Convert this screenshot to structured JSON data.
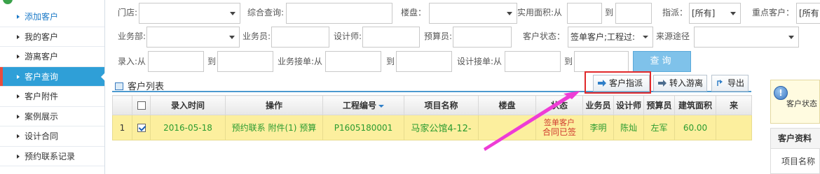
{
  "sidebar": {
    "items": [
      {
        "label": "添加客户"
      },
      {
        "label": "我的客户"
      },
      {
        "label": "游离客户"
      },
      {
        "label": "客户查询"
      },
      {
        "label": "客户附件"
      },
      {
        "label": "案例展示"
      },
      {
        "label": "设计合同"
      },
      {
        "label": "预约联系记录"
      }
    ],
    "active_index": 3
  },
  "filters": {
    "store_label": "门店:",
    "store_value": "",
    "combined_query_label": "综合查询:",
    "property_label": "楼盘：",
    "area_label_from": "实用面积:从",
    "area_to": "到",
    "assign_label": "指派：",
    "assign_value": "[所有]",
    "key_customer_label": "重点客户：",
    "key_customer_value": "[所有",
    "department_label": "业务部:",
    "salesman_label": "业务员:",
    "designer_label": "设计师:",
    "estimator_label": "预算员:",
    "customer_status_label": "客户状态：",
    "customer_status_value": "签单客户;工程过:",
    "source_label": "来源途径",
    "entry_label_from": "录入:从",
    "entry_to": "到",
    "biz_accept_label_from": "业务接单:从",
    "biz_accept_to": "到",
    "design_accept_label_from": "设计接单:从",
    "design_accept_to": "到",
    "query_button": "查询"
  },
  "list": {
    "title": "客户列表",
    "assign_button": "客户指派",
    "transfer_button": "转入游离",
    "export_button": "导出"
  },
  "table": {
    "columns": [
      "",
      "",
      "录入时间",
      "操作",
      "工程编号",
      "项目名称",
      "楼盘",
      "状态",
      "业务员",
      "设计师",
      "预算员",
      "建筑面积",
      "来"
    ],
    "rows": [
      {
        "index": "1",
        "checked": true,
        "entry_time": "2016-05-18",
        "actions": "预约联系 附件(1) 预算",
        "project_no": "P1605180001",
        "project_name": "马家公馆4-12-",
        "property": "",
        "status_line1": "签单客户",
        "status_line2": "合同已签",
        "salesman": "李明",
        "designer": "陈灿",
        "estimator": "左军",
        "area": "60.00",
        "source": ""
      }
    ]
  },
  "right_panel": {
    "status_text": "客户状态",
    "tab_label": "客户资料",
    "row_label": "项目名称"
  },
  "colors": {
    "sidebar_active": "#2f9fd7",
    "active_marker": "#e84c3d",
    "row_highlight": "#fcef9e",
    "green_text": "#2a9b2f",
    "status_red": "#d03a2f",
    "annotation_red": "#e0282a",
    "annotation_arrow": "#ee3cd6",
    "query_button": "#7fc2ea"
  }
}
